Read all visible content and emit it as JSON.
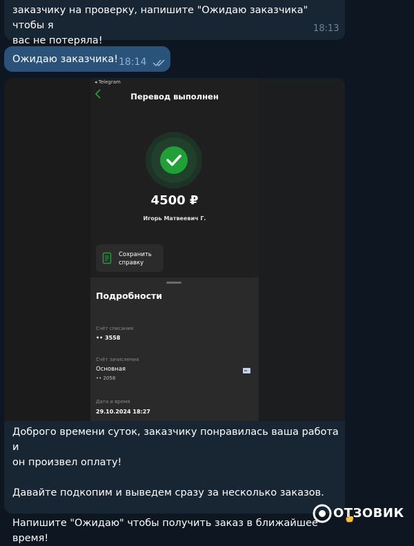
{
  "messages": {
    "m1": {
      "text": "заказчику на проверку, напишите \"Ожидаю заказчика\" чтобы я\nвас не потеряла!",
      "time": "18:13"
    },
    "m2": {
      "text": "Ожидаю заказчика!",
      "time": "18:14",
      "status": "read"
    },
    "m3": {
      "text": "Доброго времени суток, заказчику понравилась ваша работа и\nон произвел оплату!\n\nДавайте подкопим и выведем сразу за несколько заказов.\n\nНапишите \"Ожидаю\" чтобы получить заказ в ближайшее время!",
      "screenshot": {
        "status_bar": "◂ Telegram",
        "title": "Перевод выполнен",
        "amount": "4500 ₽",
        "payee": "Игорь Матвеевич Г.",
        "save_button": "Сохранить\nсправку",
        "details_title": "Подробности",
        "debit_label": "Счёт списания",
        "debit_value": "•• 3558",
        "credit_label": "Счёт зачисления",
        "credit_value": "Основная",
        "credit_sub": "•• 2058",
        "date_label": "Дата и время",
        "date_value": "29.10.2024 18:27"
      }
    }
  },
  "watermark": "ОТЗОВИК",
  "colors": {
    "background": "#0e1621",
    "incoming_bubble": "#182533",
    "outgoing_bubble": "#2b5278",
    "success_green": "#21a038"
  },
  "icons": [
    "back-arrow-icon",
    "check-icon",
    "document-icon",
    "card-icon",
    "double-check-icon",
    "otzovik-logo-icon",
    "hand-emoji-icon"
  ]
}
